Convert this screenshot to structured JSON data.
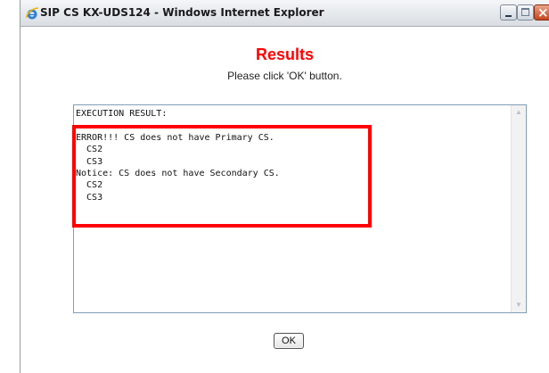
{
  "window": {
    "title": "SIP CS KX-UDS124 - Windows Internet Explorer",
    "icon": "ie-icon",
    "controls": {
      "minimize": "minimize-icon",
      "maximize": "maximize-icon",
      "close": "close-icon",
      "close_glyph": "×"
    }
  },
  "page": {
    "heading": "Results",
    "instruction": "Please click 'OK' button.",
    "ok_label": "OK"
  },
  "result": {
    "text": "EXECUTION RESULT:\n\nERROR!!! CS does not have Primary CS.\n  CS2\n  CS3\nNotice: CS does not have Secondary CS.\n  CS2\n  CS3"
  },
  "colors": {
    "heading": "#ff0000",
    "highlight_border": "#ff0000",
    "textarea_border": "#7f9db9"
  }
}
